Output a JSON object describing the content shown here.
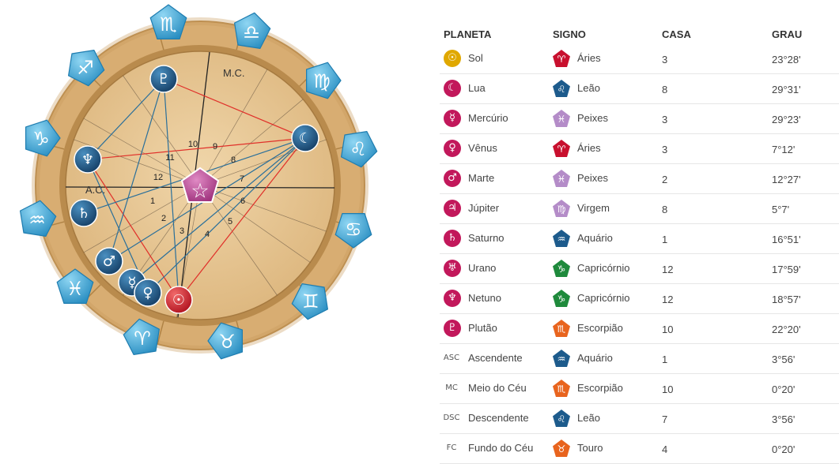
{
  "wheel": {
    "label_mc": "M.C.",
    "label_ac": "A.C.",
    "houses": [
      "1",
      "2",
      "3",
      "4",
      "5",
      "6",
      "7",
      "8",
      "9",
      "10",
      "11",
      "12"
    ],
    "zodiac_glyphs": [
      "♏",
      "♎",
      "♍",
      "♌",
      "♋",
      "♊",
      "♉",
      "♈",
      "♓",
      "♒",
      "♑",
      "♐"
    ],
    "zodiac_names": [
      "scorpio",
      "libra",
      "virgo",
      "leo",
      "cancer",
      "gemini",
      "taurus",
      "aries",
      "pisces",
      "aquarius",
      "capricorn",
      "sagittarius"
    ],
    "planet_glyphs": {
      "pluto": "♇",
      "moon": "☾",
      "neptune": "♆",
      "saturn": "♄",
      "mars": "♂",
      "mercury": "☿",
      "venus": "♀",
      "sun": "☉",
      "uranus": "♅",
      "center": "☆"
    },
    "colors": {
      "ring": "#d9b078",
      "ring_dark": "#b98b4d",
      "inner": "#e8c898",
      "sign_blue": "#3aa6d4",
      "planet_blue": "#1f5d8f",
      "sun_red": "#d6283a",
      "center": "#b43d8c",
      "line_red": "#e0302a",
      "line_blue": "#2a6f9a"
    }
  },
  "table": {
    "headers": {
      "planet": "PLANETA",
      "sign": "SIGNO",
      "house": "CASA",
      "degree": "GRAU"
    },
    "rows": [
      {
        "planet": "Sol",
        "planet_icon": "☉",
        "planet_color": "#e0a800",
        "sign": "Áries",
        "sign_icon": "♈",
        "sign_color": "#c8102e",
        "house": "3",
        "degree": "23°28'"
      },
      {
        "planet": "Lua",
        "planet_icon": "☾",
        "planet_color": "#c2185b",
        "sign": "Leão",
        "sign_icon": "♌",
        "sign_color": "#1d5b8c",
        "house": "8",
        "degree": "29°31'"
      },
      {
        "planet": "Mercúrio",
        "planet_icon": "☿",
        "planet_color": "#c2185b",
        "sign": "Peixes",
        "sign_icon": "♓",
        "sign_color": "#b48cc8",
        "house": "3",
        "degree": "29°23'"
      },
      {
        "planet": "Vênus",
        "planet_icon": "♀",
        "planet_color": "#c2185b",
        "sign": "Áries",
        "sign_icon": "♈",
        "sign_color": "#c8102e",
        "house": "3",
        "degree": "7°12'"
      },
      {
        "planet": "Marte",
        "planet_icon": "♂",
        "planet_color": "#c2185b",
        "sign": "Peixes",
        "sign_icon": "♓",
        "sign_color": "#b48cc8",
        "house": "2",
        "degree": "12°27'"
      },
      {
        "planet": "Júpiter",
        "planet_icon": "♃",
        "planet_color": "#c2185b",
        "sign": "Virgem",
        "sign_icon": "♍",
        "sign_color": "#b48cc8",
        "house": "8",
        "degree": "5°7'"
      },
      {
        "planet": "Saturno",
        "planet_icon": "♄",
        "planet_color": "#c2185b",
        "sign": "Aquário",
        "sign_icon": "♒",
        "sign_color": "#1d5b8c",
        "house": "1",
        "degree": "16°51'"
      },
      {
        "planet": "Urano",
        "planet_icon": "♅",
        "planet_color": "#c2185b",
        "sign": "Capricórnio",
        "sign_icon": "♑",
        "sign_color": "#1f8a3c",
        "house": "12",
        "degree": "17°59'"
      },
      {
        "planet": "Netuno",
        "planet_icon": "♆",
        "planet_color": "#c2185b",
        "sign": "Capricórnio",
        "sign_icon": "♑",
        "sign_color": "#1f8a3c",
        "house": "12",
        "degree": "18°57'"
      },
      {
        "planet": "Plutão",
        "planet_icon": "♇",
        "planet_color": "#c2185b",
        "sign": "Escorpião",
        "sign_icon": "♏",
        "sign_color": "#e8641e",
        "house": "10",
        "degree": "22°20'"
      },
      {
        "planet": "Ascendente",
        "planet_icon": "ASC",
        "planet_color": "",
        "sign": "Aquário",
        "sign_icon": "♒",
        "sign_color": "#1d5b8c",
        "house": "1",
        "degree": "3°56'"
      },
      {
        "planet": "Meio do Céu",
        "planet_icon": "MC",
        "planet_color": "",
        "sign": "Escorpião",
        "sign_icon": "♏",
        "sign_color": "#e8641e",
        "house": "10",
        "degree": "0°20'"
      },
      {
        "planet": "Descendente",
        "planet_icon": "DSC",
        "planet_color": "",
        "sign": "Leão",
        "sign_icon": "♌",
        "sign_color": "#1d5b8c",
        "house": "7",
        "degree": "3°56'"
      },
      {
        "planet": "Fundo do Céu",
        "planet_icon": "FC",
        "planet_color": "",
        "sign": "Touro",
        "sign_icon": "♉",
        "sign_color": "#e8641e",
        "house": "4",
        "degree": "0°20'"
      }
    ]
  }
}
